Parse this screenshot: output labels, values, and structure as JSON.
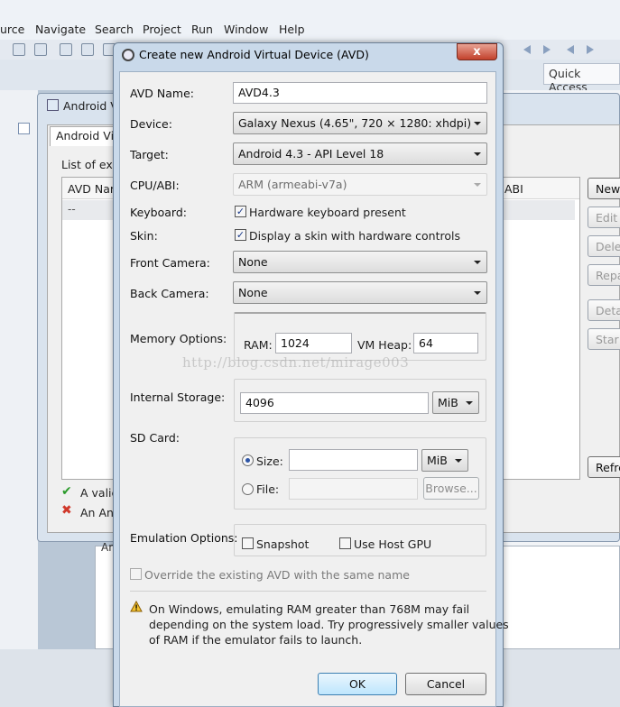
{
  "menubar": {
    "items": [
      "urce",
      "Navigate",
      "Search",
      "Project",
      "Run",
      "Window",
      "Help"
    ]
  },
  "toolbar": {
    "quick_access": "Quick Access"
  },
  "background_manager": {
    "title": "Android V",
    "tab": "Android Vi",
    "list_label": "List of exi",
    "columns": [
      "AVD Nar",
      "ABI"
    ],
    "row_placeholder": "--",
    "buttons": [
      "New",
      "Edit",
      "Delet",
      "Repa",
      "Detai",
      "Star",
      "Refre"
    ],
    "legend": [
      "A valic",
      "An An"
    ],
    "lower_tab": "An"
  },
  "dialog": {
    "title": "Create new Android Virtual Device (AVD)",
    "close": "x",
    "avd_name_label": "AVD Name:",
    "avd_name_value": "AVD4.3",
    "device_label": "Device:",
    "device_value": "Galaxy Nexus (4.65\", 720 × 1280: xhdpi)",
    "target_label": "Target:",
    "target_value": "Android 4.3 - API Level 18",
    "cpu_label": "CPU/ABI:",
    "cpu_value": "ARM (armeabi-v7a)",
    "keyboard_label": "Keyboard:",
    "keyboard_option": "Hardware keyboard present",
    "skin_label": "Skin:",
    "skin_option": "Display a skin with hardware controls",
    "front_camera_label": "Front Camera:",
    "front_camera_value": "None",
    "back_camera_label": "Back Camera:",
    "back_camera_value": "None",
    "memory_label": "Memory Options:",
    "ram_label": "RAM:",
    "ram_value": "1024",
    "vm_heap_label": "VM Heap:",
    "vm_heap_value": "64",
    "internal_storage_label": "Internal Storage:",
    "internal_storage_value": "4096",
    "internal_storage_unit": "MiB",
    "sd_card_label": "SD Card:",
    "sd_size_label": "Size:",
    "sd_size_value": "",
    "sd_size_unit": "MiB",
    "sd_file_label": "File:",
    "sd_file_value": "",
    "browse_button": "Browse...",
    "emulation_label": "Emulation Options:",
    "snapshot_option": "Snapshot",
    "host_gpu_option": "Use Host GPU",
    "override_option": "Override the existing AVD with the same name",
    "warning_lines": [
      "On Windows, emulating RAM greater than 768M may fail",
      "depending on the system load. Try progressively smaller values",
      "of RAM if the emulator fails to launch."
    ],
    "ok_button": "OK",
    "cancel_button": "Cancel"
  },
  "watermark": "http://blog.csdn.net/mirage003"
}
